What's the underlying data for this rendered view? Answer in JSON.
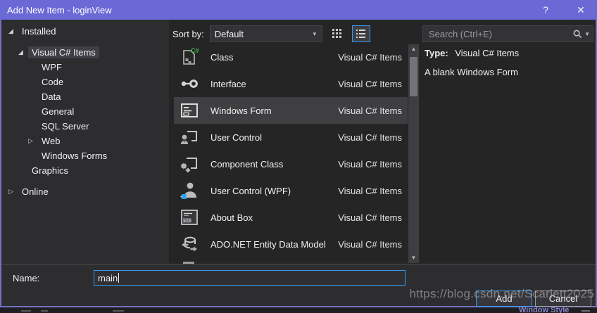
{
  "titlebar": {
    "title": "Add New Item - loginView",
    "help_glyph": "?",
    "close_glyph": "✕"
  },
  "tree": {
    "expanded_glyph": "◢",
    "collapsed_glyph": "▷",
    "items": [
      {
        "label": "Installed",
        "depth": 0,
        "expander": "expanded"
      },
      {
        "label": "Visual C# Items",
        "depth": 1,
        "expander": "expanded",
        "selected": true,
        "gap_before": true
      },
      {
        "label": "WPF",
        "depth": 2
      },
      {
        "label": "Code",
        "depth": 2
      },
      {
        "label": "Data",
        "depth": 2
      },
      {
        "label": "General",
        "depth": 2
      },
      {
        "label": "SQL Server",
        "depth": 2
      },
      {
        "label": "Web",
        "depth": 2,
        "expander": "collapsed"
      },
      {
        "label": "Windows Forms",
        "depth": 2
      },
      {
        "label": "Graphics",
        "depth": 1
      },
      {
        "label": "Online",
        "depth": 0,
        "expander": "collapsed",
        "gap_before": true
      }
    ]
  },
  "toolbar": {
    "sort_label": "Sort by:",
    "sort_value": "Default",
    "caret_glyph": "▼"
  },
  "search": {
    "placeholder": "Search (Ctrl+E)",
    "caret_glyph": "▼"
  },
  "list": {
    "items": [
      {
        "label": "Class",
        "category": "Visual C# Items",
        "icon": "class-icon"
      },
      {
        "label": "Interface",
        "category": "Visual C# Items",
        "icon": "interface-icon"
      },
      {
        "label": "Windows Form",
        "category": "Visual C# Items",
        "icon": "windows-form-icon",
        "selected": true
      },
      {
        "label": "User Control",
        "category": "Visual C# Items",
        "icon": "user-control-icon"
      },
      {
        "label": "Component Class",
        "category": "Visual C# Items",
        "icon": "component-class-icon"
      },
      {
        "label": "User Control (WPF)",
        "category": "Visual C# Items",
        "icon": "user-control-wpf-icon"
      },
      {
        "label": "About Box",
        "category": "Visual C# Items",
        "icon": "about-box-icon"
      },
      {
        "label": "ADO.NET Entity Data Model",
        "category": "Visual C# Items",
        "icon": "ado-net-entity-icon"
      },
      {
        "label": "",
        "category": "",
        "icon": "partial-item-icon"
      }
    ]
  },
  "scrollbar": {
    "up_glyph": "▲",
    "down_glyph": "▼"
  },
  "info": {
    "type_label": "Type:",
    "type_value": "Visual C# Items",
    "description": "A blank Windows Form"
  },
  "footer": {
    "name_label": "Name:",
    "name_value": "main",
    "add_label": "Add",
    "cancel_label": "Cancel"
  },
  "watermark": {
    "text": "https://blog.csdn.net/Scarlett2025"
  },
  "bottom_strip": {
    "fragment_text": "Window Style"
  },
  "colors": {
    "titlebar": "#6b69d6",
    "dialog_bg": "#2d2d30",
    "list_bg": "#252526",
    "selection_bg": "#3f3f41",
    "focus_border": "#3899f2",
    "csharp_green": "#3fbf3f"
  }
}
